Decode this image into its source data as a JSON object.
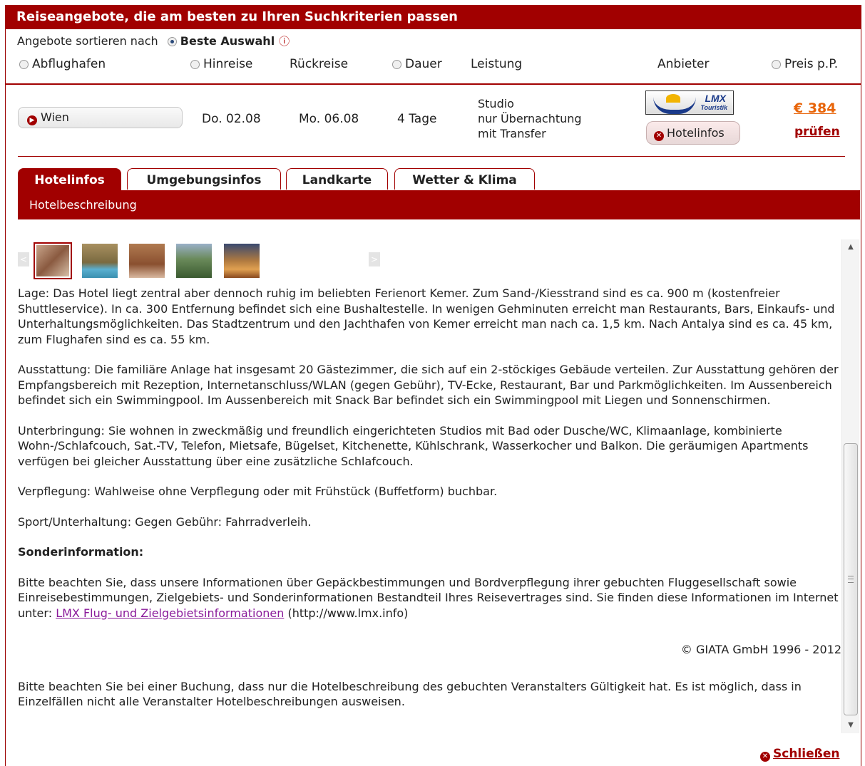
{
  "header": {
    "title": "Reiseangebote, die am besten zu Ihren Suchkriterien passen"
  },
  "sort": {
    "label": "Angebote sortieren nach",
    "selected": "Beste Auswahl",
    "info_icon": "info-icon"
  },
  "columns": {
    "abflughafen": "Abflughafen",
    "hinreise": "Hinreise",
    "rueckreise": "Rückreise",
    "dauer": "Dauer",
    "leistung": "Leistung",
    "anbieter": "Anbieter",
    "preis": "Preis p.P."
  },
  "offer": {
    "airport": "Wien",
    "depart": "Do. 02.08",
    "return": "Mo. 06.08",
    "duration": "4 Tage",
    "service_line1": "Studio",
    "service_line2": "nur Übernachtung",
    "service_line3": "mit Transfer",
    "provider_logo_text": "LMX",
    "provider_logo_sub": "Touristik",
    "hotelinfo_button": "Hotelinfos",
    "price": "€ 384",
    "check": "prüfen"
  },
  "tabs": [
    {
      "label": "Hotelinfos",
      "active": true
    },
    {
      "label": "Umgebungsinfos",
      "active": false
    },
    {
      "label": "Landkarte",
      "active": false
    },
    {
      "label": "Wetter & Klima",
      "active": false
    }
  ],
  "subbar": {
    "title": "Hotelbeschreibung"
  },
  "gallery": {
    "prev": "<",
    "next": ">"
  },
  "description": {
    "lage": "Lage: Das Hotel liegt zentral aber dennoch ruhig im beliebten Ferienort Kemer. Zum Sand-/Kiesstrand sind es ca. 900 m (kostenfreier Shuttleservice). In ca. 300 Entfernung befindet sich eine Bushaltestelle. In wenigen Gehminuten erreicht man Restaurants, Bars, Einkaufs- und Unterhaltungsmöglichkeiten. Das Stadtzentrum und den Jachthafen von Kemer erreicht man nach ca. 1,5 km. Nach Antalya sind es ca. 45 km, zum Flughafen sind es ca. 55 km.",
    "ausstattung": "Ausstattung: Die familiäre Anlage hat insgesamt 20 Gästezimmer, die sich auf ein 2-stöckiges Gebäude verteilen. Zur Ausstattung gehören der Empfangsbereich mit Rezeption, Internetanschluss/WLAN (gegen Gebühr), TV-Ecke, Restaurant, Bar und Parkmöglichkeiten. Im Aussenbereich befindet sich ein Swimmingpool. Im Aussenbereich mit Snack Bar befindet sich ein Swimmingpool mit Liegen und Sonnenschirmen.",
    "unterbringung": "Unterbringung: Sie wohnen in zweckmäßig und freundlich eingerichteten Studios mit Bad oder Dusche/WC, Klimaanlage, kombinierte Wohn-/Schlafcouch, Sat.-TV, Telefon, Mietsafe, Bügelset, Kitchenette, Kühlschrank, Wasserkocher und Balkon. Die geräumigen Apartments verfügen bei gleicher Ausstattung über eine zusätzliche Schlafcouch.",
    "verpflegung": "Verpflegung: Wahlweise ohne Verpflegung oder mit Frühstück (Buffetform) buchbar.",
    "sport": "Sport/Unterhaltung: Gegen Gebühr: Fahrradverleih.",
    "sonder_title": "Sonderinformation:",
    "sonder_text": "Bitte beachten Sie, dass unsere Informationen über Gepäckbestimmungen und Bordverpflegung ihrer gebuchten Fluggesellschaft sowie Einreisebestimmungen, Zielgebiets- und Sonderinformationen Bestandteil Ihres Reisevertrages sind. Sie finden diese Informationen im Internet unter:",
    "sonder_link": "LMX Flug- und Zielgebietsinformationen",
    "sonder_url": "(http://www.lmx.info)",
    "copyright": "© GIATA GmbH 1996 - 2012",
    "hinweis": "Bitte beachten Sie bei einer Buchung, dass nur die Hotelbeschreibung des gebuchten Veranstalters Gültigkeit hat. Es ist möglich, dass in Einzelfällen nicht alle Veranstalter Hotelbeschreibungen ausweisen."
  },
  "footer": {
    "close": "Schließen"
  },
  "colors": {
    "brand": "#a10000",
    "price": "#e8650a",
    "link": "#8a1a9a"
  }
}
